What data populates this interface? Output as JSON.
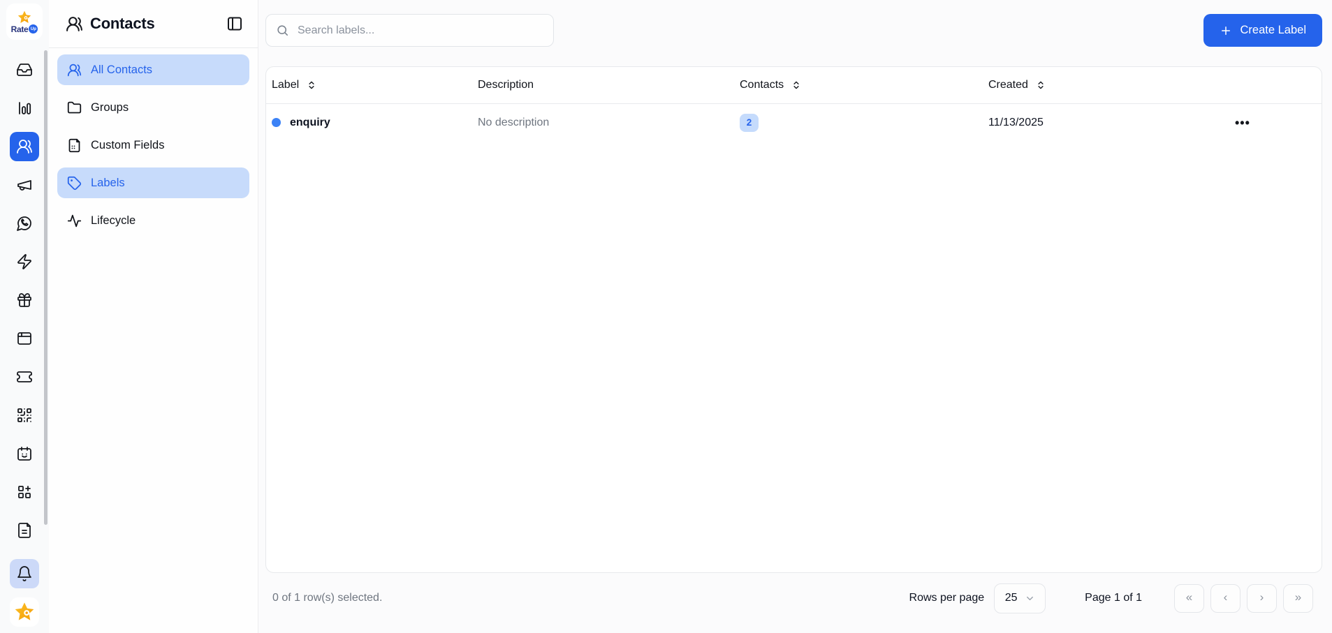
{
  "brand": {
    "logo_text": "Rate",
    "logo_badge": "Up"
  },
  "colors": {
    "accent": "#2563eb",
    "accent_light": "#c7dbfb",
    "badge_bg": "#c5dbfc",
    "row_dot": "#3b82f6",
    "star_orange": "#f59e0b",
    "bell_bg": "#ccd9f8"
  },
  "rail": {
    "items": [
      {
        "icon": "inbox-icon"
      },
      {
        "icon": "bar-chart-icon"
      },
      {
        "icon": "users-icon",
        "active": true
      },
      {
        "icon": "megaphone-icon"
      },
      {
        "icon": "whatsapp-icon"
      },
      {
        "icon": "zap-icon"
      },
      {
        "icon": "gift-icon"
      },
      {
        "icon": "browser-window-icon"
      },
      {
        "icon": "ticket-icon"
      },
      {
        "icon": "qr-code-icon"
      },
      {
        "icon": "calendar-smile-icon"
      },
      {
        "icon": "apps-plus-icon"
      },
      {
        "icon": "document-icon"
      }
    ],
    "bottom": [
      {
        "icon": "bell-icon",
        "highlighted": true
      },
      {
        "icon": "star-avatar"
      }
    ]
  },
  "sidebar": {
    "title": "Contacts",
    "items": [
      {
        "label": "All Contacts",
        "icon": "users-icon",
        "active": true
      },
      {
        "label": "Groups",
        "icon": "folder-icon",
        "active": false
      },
      {
        "label": "Custom Fields",
        "icon": "file-fields-icon",
        "active": false
      },
      {
        "label": "Labels",
        "icon": "tag-icon",
        "active": true
      },
      {
        "label": "Lifecycle",
        "icon": "activity-icon",
        "active": false
      }
    ]
  },
  "topbar": {
    "search_placeholder": "Search labels...",
    "create_label": "Create Label"
  },
  "table": {
    "columns": [
      {
        "label": "Label",
        "sortable": true
      },
      {
        "label": "Description",
        "sortable": false
      },
      {
        "label": "Contacts",
        "sortable": true
      },
      {
        "label": "Created",
        "sortable": true
      },
      {
        "label": "",
        "sortable": false
      }
    ],
    "rows": [
      {
        "label": "enquiry",
        "description": "No description",
        "contacts": "2",
        "created": "11/13/2025",
        "menu_glyph": "•••"
      }
    ]
  },
  "footer": {
    "selected_text": "0 of 1 row(s) selected.",
    "rows_per_page_label": "Rows per page",
    "rows_per_page_value": "25",
    "page_text": "Page 1 of 1",
    "pagination": {
      "first": "«",
      "prev": "‹",
      "next": "›",
      "last": "»"
    }
  }
}
